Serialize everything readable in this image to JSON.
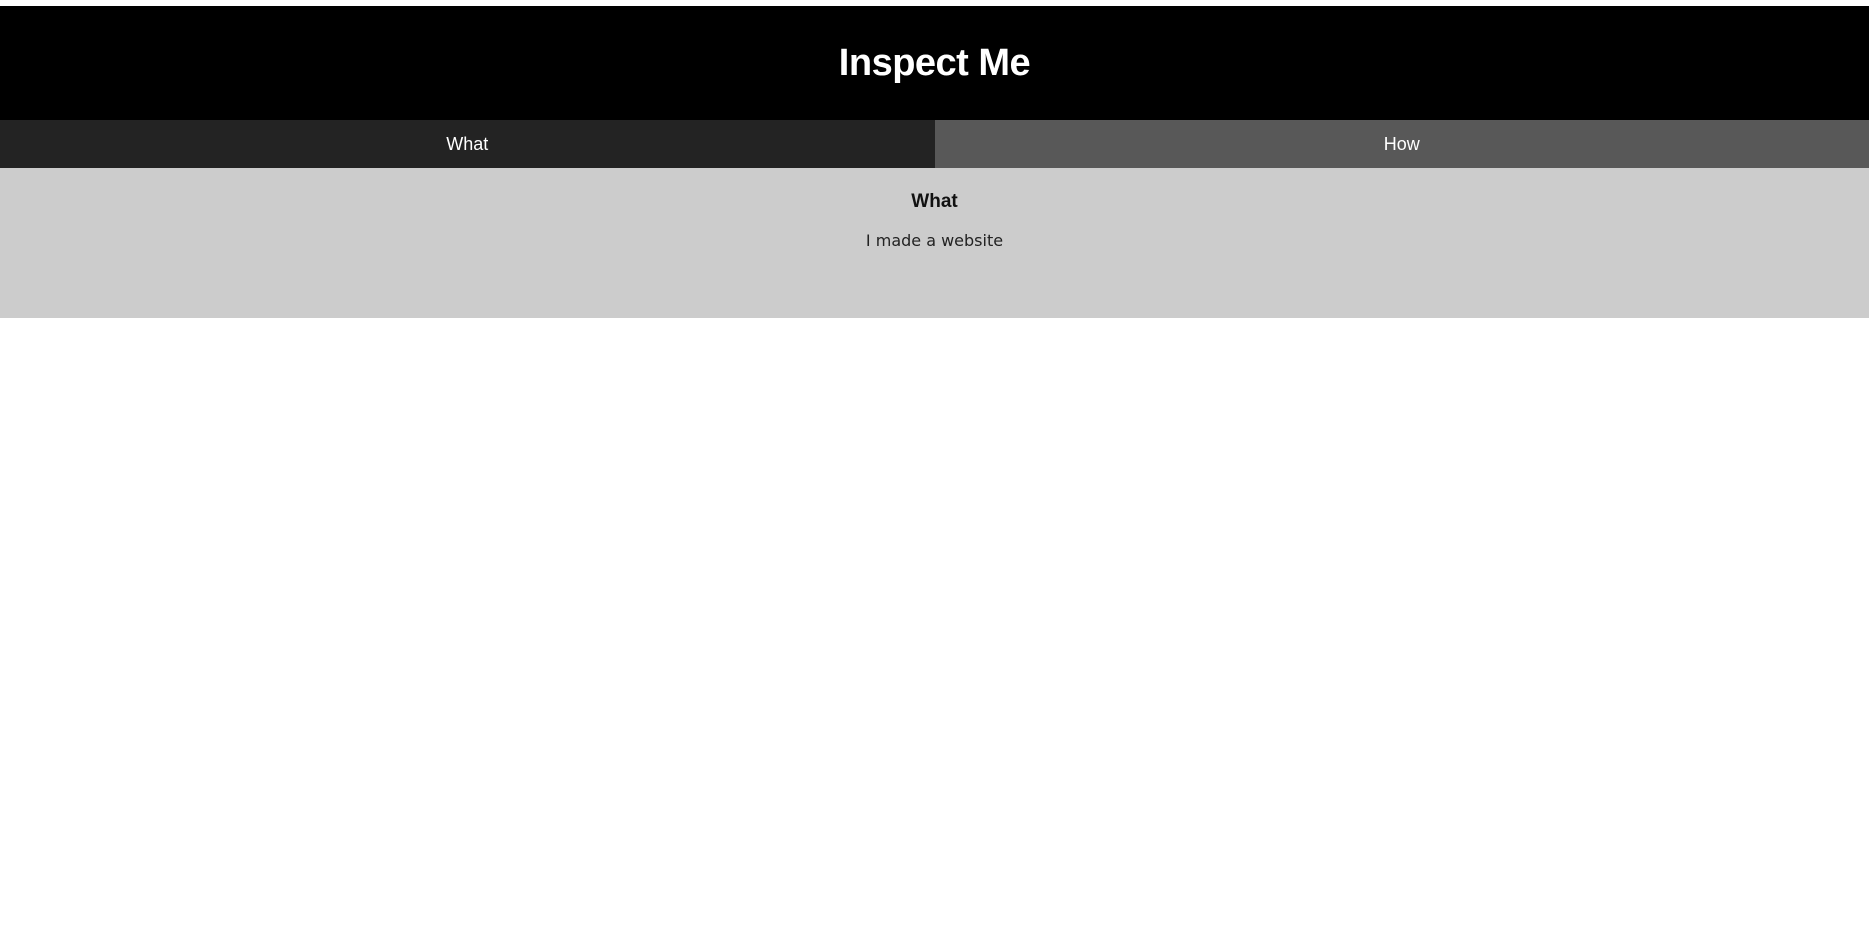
{
  "header": {
    "title": "Inspect Me"
  },
  "tabs": [
    {
      "label": "What",
      "active": true
    },
    {
      "label": "How",
      "active": false
    }
  ],
  "panel": {
    "heading": "What",
    "text": "I made a website"
  },
  "colors": {
    "header_bg": "#000000",
    "active_tab_bg": "#232323",
    "inactive_tab_bg": "#585858",
    "panel_bg": "#cccccc",
    "page_bg": "#ffffff"
  }
}
